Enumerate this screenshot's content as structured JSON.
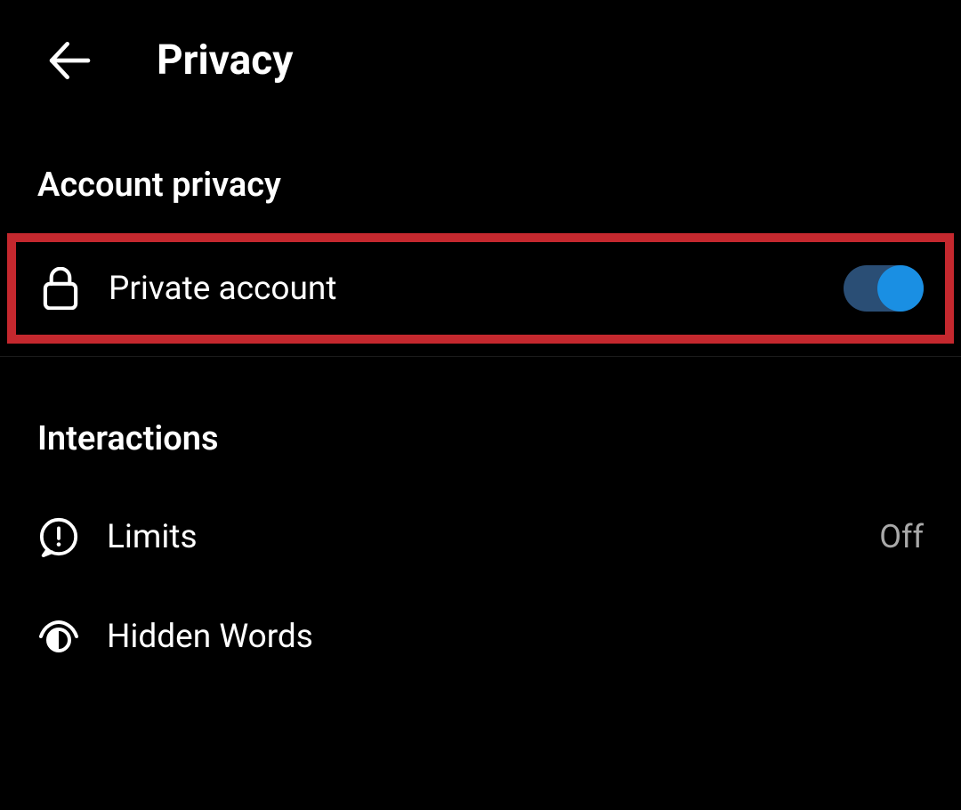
{
  "header": {
    "title": "Privacy"
  },
  "sections": {
    "account_privacy": {
      "title": "Account privacy",
      "private_account": {
        "label": "Private account",
        "enabled": true
      }
    },
    "interactions": {
      "title": "Interactions",
      "limits": {
        "label": "Limits",
        "value": "Off"
      },
      "hidden_words": {
        "label": "Hidden Words"
      }
    }
  }
}
